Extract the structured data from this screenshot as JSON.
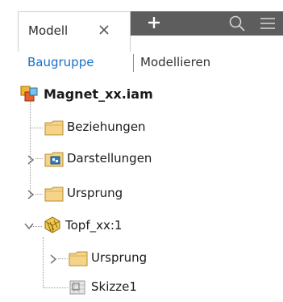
{
  "tabs": {
    "active_label": "Modell",
    "add_symbol": "+"
  },
  "modes": {
    "assembly": "Baugruppe",
    "modeling": "Modellieren"
  },
  "tree": {
    "root": "Magnet_xx.iam",
    "items": [
      {
        "label": "Beziehungen",
        "icon": "folder-icon",
        "expandable": false
      },
      {
        "label": "Darstellungen",
        "icon": "representations-icon",
        "expandable": true
      },
      {
        "label": "Ursprung",
        "icon": "folder-icon",
        "expandable": true
      },
      {
        "label": "Topf_xx:1",
        "icon": "part-icon",
        "expandable": true,
        "expanded": true
      },
      {
        "label": "Ursprung",
        "icon": "folder-icon",
        "expandable": true,
        "indent": 1
      },
      {
        "label": "Skizze1",
        "icon": "sketch-icon",
        "expandable": false,
        "indent": 1
      }
    ]
  },
  "colors": {
    "accent": "#1a6fc7",
    "tab_dark": "#5d5d5d",
    "folder": "#f5d489"
  }
}
